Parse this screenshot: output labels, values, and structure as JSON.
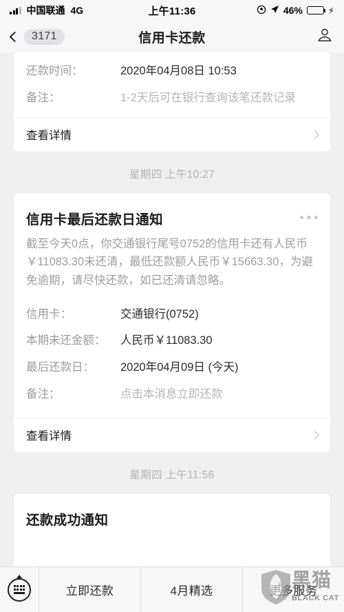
{
  "status_bar": {
    "carrier": "中国联通",
    "network": "4G",
    "time": "上午11:36",
    "battery_percent": "46%",
    "battery_color": "#fbc02d",
    "icons": [
      "signal-bars-icon",
      "rotation-lock-icon",
      "location-arrow-icon",
      "battery-icon",
      "charging-bolt-icon"
    ]
  },
  "nav_bar": {
    "back_badge": "3171",
    "title": "信用卡还款",
    "back_icon": "chevron-left-icon",
    "right_icon": "contact-person-icon"
  },
  "messages": [
    {
      "type": "card_partial",
      "rows": [
        {
          "key": "还款时间：",
          "value": "2020年04月08日 10:53",
          "muted": false
        },
        {
          "key": "备注：",
          "value": "1-2天后可在银行查询该笔还款记录",
          "muted": true
        }
      ],
      "footer": "查看详情"
    },
    {
      "type": "timestamp",
      "text": "星期四 上午10:27"
    },
    {
      "type": "card_full",
      "title": "信用卡最后还款日通知",
      "menu_icon": "more-dots-icon",
      "paragraph": "截至今天0点，你交通银行尾号0752的信用卡还有人民币￥11083.30未还清，最低还款额人民币￥15663.30，为避免逾期，请尽快还款，如已还清请忽略。",
      "rows": [
        {
          "key": "信用卡：",
          "value": "交通银行(0752)",
          "muted": false
        },
        {
          "key": "本期未还金额：",
          "value": "人民币￥11083.30",
          "muted": false
        },
        {
          "key": "最后还款日：",
          "value": "2020年04月09日 (今天)",
          "muted": false
        },
        {
          "key": "备注：",
          "value": "点击本消息立即还款",
          "muted": true
        }
      ],
      "footer": "查看详情"
    },
    {
      "type": "timestamp",
      "text": "星期四 上午11:56"
    },
    {
      "type": "card_cutoff",
      "title": "还款成功通知"
    }
  ],
  "bottom_bar": {
    "keyboard_icon": "keyboard-icon",
    "items": [
      "立即还款",
      "4月精选",
      "更多服务"
    ]
  },
  "watermark": {
    "cn": "黑猫",
    "en": "BLACK CAT",
    "icon": "shield-cat-logo-icon"
  }
}
